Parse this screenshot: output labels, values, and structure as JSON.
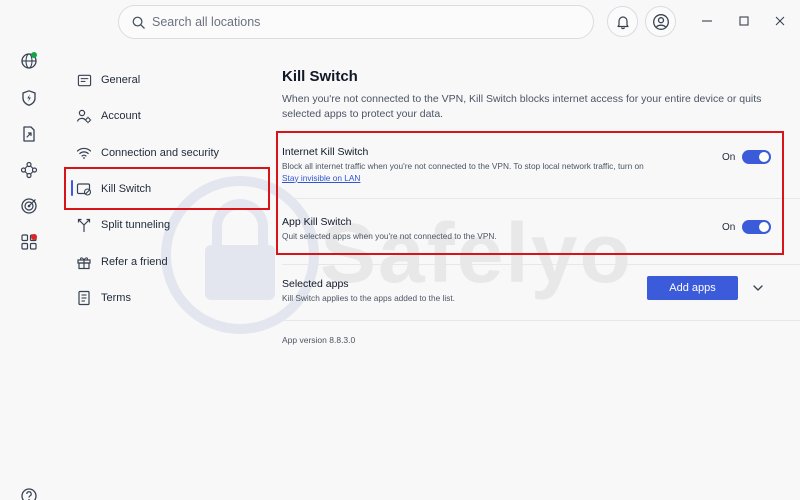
{
  "search": {
    "placeholder": "Search all locations"
  },
  "watermark": {
    "text": "Safelyo"
  },
  "nav": {
    "items": [
      {
        "id": "general",
        "label": "General",
        "icon": "general-icon"
      },
      {
        "id": "account",
        "label": "Account",
        "icon": "account-gear-icon"
      },
      {
        "id": "connection",
        "label": "Connection and security",
        "icon": "wifi-icon"
      },
      {
        "id": "killswitch",
        "label": "Kill Switch",
        "icon": "kill-switch-icon",
        "active": true
      },
      {
        "id": "split",
        "label": "Split tunneling",
        "icon": "split-tunneling-icon"
      },
      {
        "id": "refer",
        "label": "Refer a friend",
        "icon": "gift-icon"
      },
      {
        "id": "terms",
        "label": "Terms",
        "icon": "document-icon"
      }
    ]
  },
  "content": {
    "title": "Kill Switch",
    "description": "When you're not connected to the VPN, Kill Switch blocks internet access for your entire device or quits selected apps to protect your data.",
    "internet": {
      "title": "Internet Kill Switch",
      "desc": "Block all internet traffic when you're not connected to the VPN. To stop local network traffic, turn on",
      "link": "Stay invisible on LAN",
      "state": "On"
    },
    "app": {
      "title": "App Kill Switch",
      "desc": "Quit selected apps when you're not connected to the VPN.",
      "state": "On"
    },
    "selected": {
      "title": "Selected apps",
      "desc": "Kill Switch applies to the apps added to the list.",
      "button": "Add apps"
    },
    "version": "App version 8.8.3.0"
  },
  "colors": {
    "accent": "#3b5bdb",
    "highlight": "#d7141a",
    "notification_green": "#16a34a",
    "notification_red": "#dc2626"
  }
}
